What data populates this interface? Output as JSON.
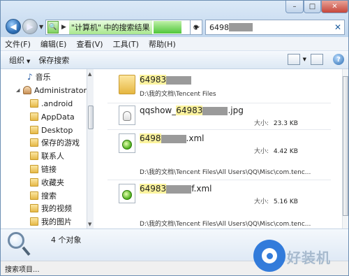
{
  "window": {
    "controls": {
      "min": "–",
      "max": "□",
      "close": "✕"
    }
  },
  "address": {
    "crumb": "\"计算机\" 中的搜索结果"
  },
  "search": {
    "query": "6498"
  },
  "menu": [
    "文件(F)",
    "编辑(E)",
    "查看(V)",
    "工具(T)",
    "帮助(H)"
  ],
  "toolbar": {
    "organize": "组织",
    "save_search": "保存搜索"
  },
  "navpane": {
    "items": [
      {
        "label": "音乐",
        "icon": "music-icon"
      },
      {
        "label": "Administrator",
        "icon": "user-icon"
      },
      {
        "label": ".android",
        "icon": "folder-icon"
      },
      {
        "label": "AppData",
        "icon": "folder-icon"
      },
      {
        "label": "Desktop",
        "icon": "folder-icon"
      },
      {
        "label": "保存的游戏",
        "icon": "folder-icon"
      },
      {
        "label": "联系人",
        "icon": "folder-icon"
      },
      {
        "label": "链接",
        "icon": "folder-icon"
      },
      {
        "label": "收藏夹",
        "icon": "folder-icon"
      },
      {
        "label": "搜索",
        "icon": "folder-icon"
      },
      {
        "label": "我的视频",
        "icon": "folder-icon"
      },
      {
        "label": "我的图片",
        "icon": "folder-icon"
      }
    ]
  },
  "results": [
    {
      "name_hl": "64983",
      "name_rest": "",
      "path": "D:\\我的文档\\Tencent Files",
      "size_label": "",
      "size": ""
    },
    {
      "name_pre": "qqshow_",
      "name_hl": "64983",
      "name_rest": ".jpg",
      "path": "",
      "size_label": "大小",
      "size": "23.3 KB"
    },
    {
      "name_hl": "6498",
      "name_rest": ".xml",
      "path": "D:\\我的文档\\Tencent Files\\All Users\\QQ\\Misc\\com.tenc...",
      "size_label": "大小",
      "size": "4.42 KB"
    },
    {
      "name_hl": "64983",
      "name_rest": "f.xml",
      "path": "D:\\我的文档\\Tencent Files\\All Users\\QQ\\Misc\\com.tenc...",
      "size_label": "大小",
      "size": "5.16 KB"
    }
  ],
  "details": {
    "count": "4 个对象"
  },
  "status": {
    "text": "搜索项目..."
  },
  "watermark": {
    "text": "好装机"
  }
}
